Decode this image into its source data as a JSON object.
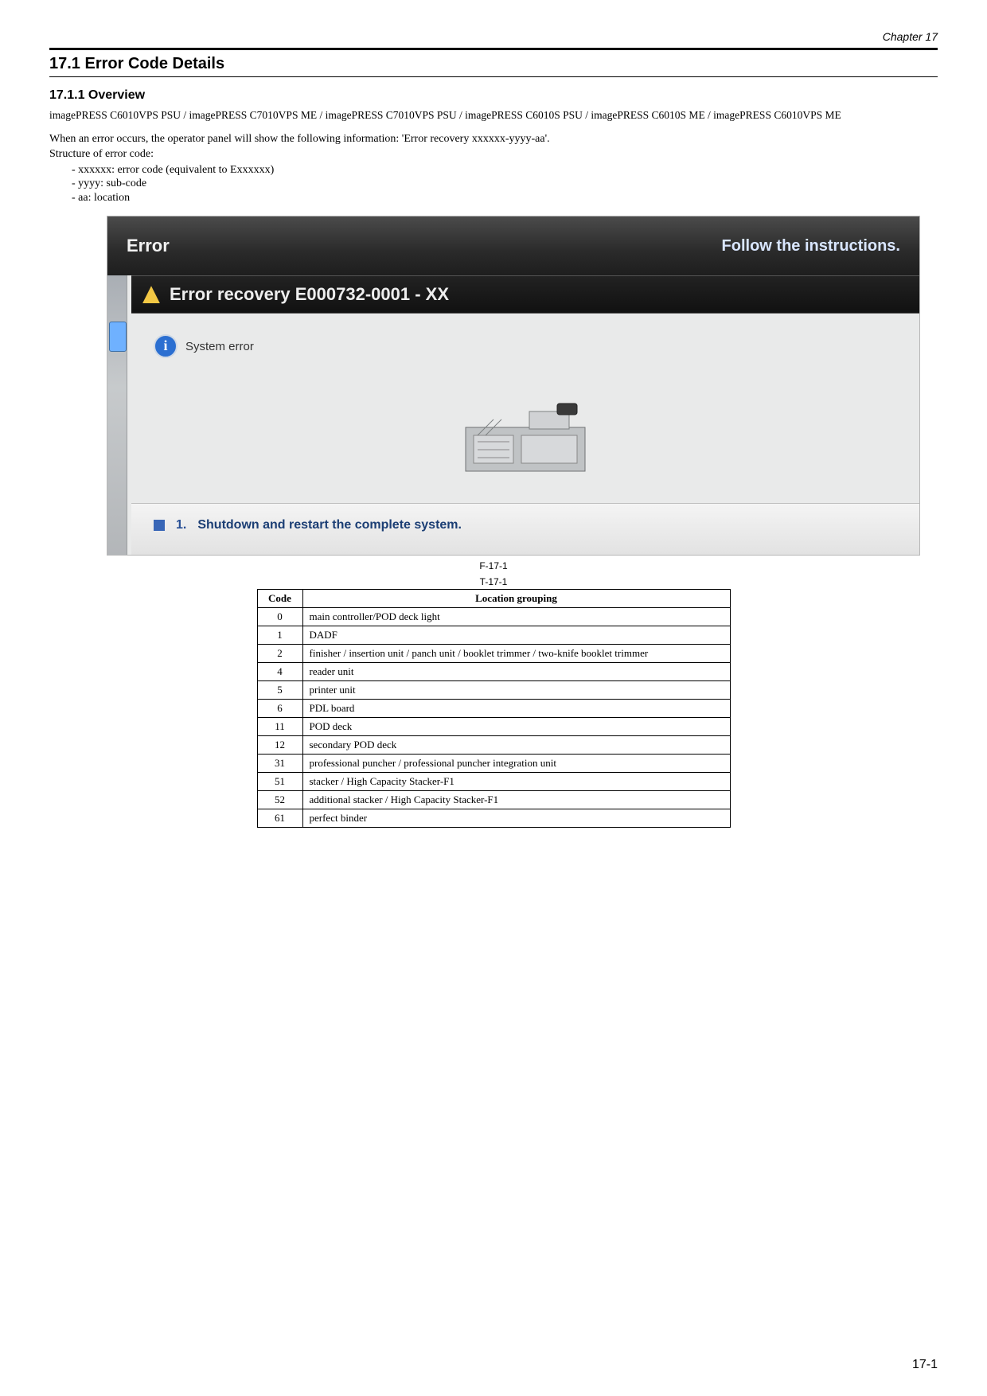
{
  "chapter": "Chapter 17",
  "section_title": "17.1 Error Code Details",
  "subsection_title": "17.1.1 Overview",
  "model_line": "imagePRESS C6010VPS PSU / imagePRESS C7010VPS ME / imagePRESS C7010VPS PSU / imagePRESS C6010S PSU / imagePRESS C6010S ME / imagePRESS C6010VPS ME",
  "intro_line1": "When an error occurs, the operator panel will show the following information: 'Error recovery xxxxxx-yyyy-aa'.",
  "intro_line2": "Structure of error code:",
  "bullets": [
    "- xxxxxx: error code (equivalent to Exxxxxx)",
    "- yyyy: sub-code",
    "- aa: location"
  ],
  "screenshot": {
    "error_label": "Error",
    "instructions_label": "Follow the instructions.",
    "recovery_text": "Error recovery E000732-0001 - XX",
    "system_error": "System error",
    "step_num": "1.",
    "step_text": "Shutdown and restart the complete system."
  },
  "figure_label": "F-17-1",
  "table_label": "T-17-1",
  "table_headers": {
    "code": "Code",
    "desc": "Location grouping"
  },
  "table_rows": [
    {
      "code": "0",
      "desc": "main controller/POD deck light"
    },
    {
      "code": "1",
      "desc": "DADF"
    },
    {
      "code": "2",
      "desc": "finisher / insertion unit / panch unit / booklet trimmer / two-knife booklet trimmer"
    },
    {
      "code": "4",
      "desc": "reader unit"
    },
    {
      "code": "5",
      "desc": "printer unit"
    },
    {
      "code": "6",
      "desc": "PDL board"
    },
    {
      "code": "11",
      "desc": "POD deck"
    },
    {
      "code": "12",
      "desc": "secondary POD deck"
    },
    {
      "code": "31",
      "desc": "professional puncher / professional puncher integration unit"
    },
    {
      "code": "51",
      "desc": "stacker / High Capacity Stacker-F1"
    },
    {
      "code": "52",
      "desc": "additional stacker / High Capacity Stacker-F1"
    },
    {
      "code": "61",
      "desc": "perfect binder"
    }
  ],
  "page_number": "17-1"
}
